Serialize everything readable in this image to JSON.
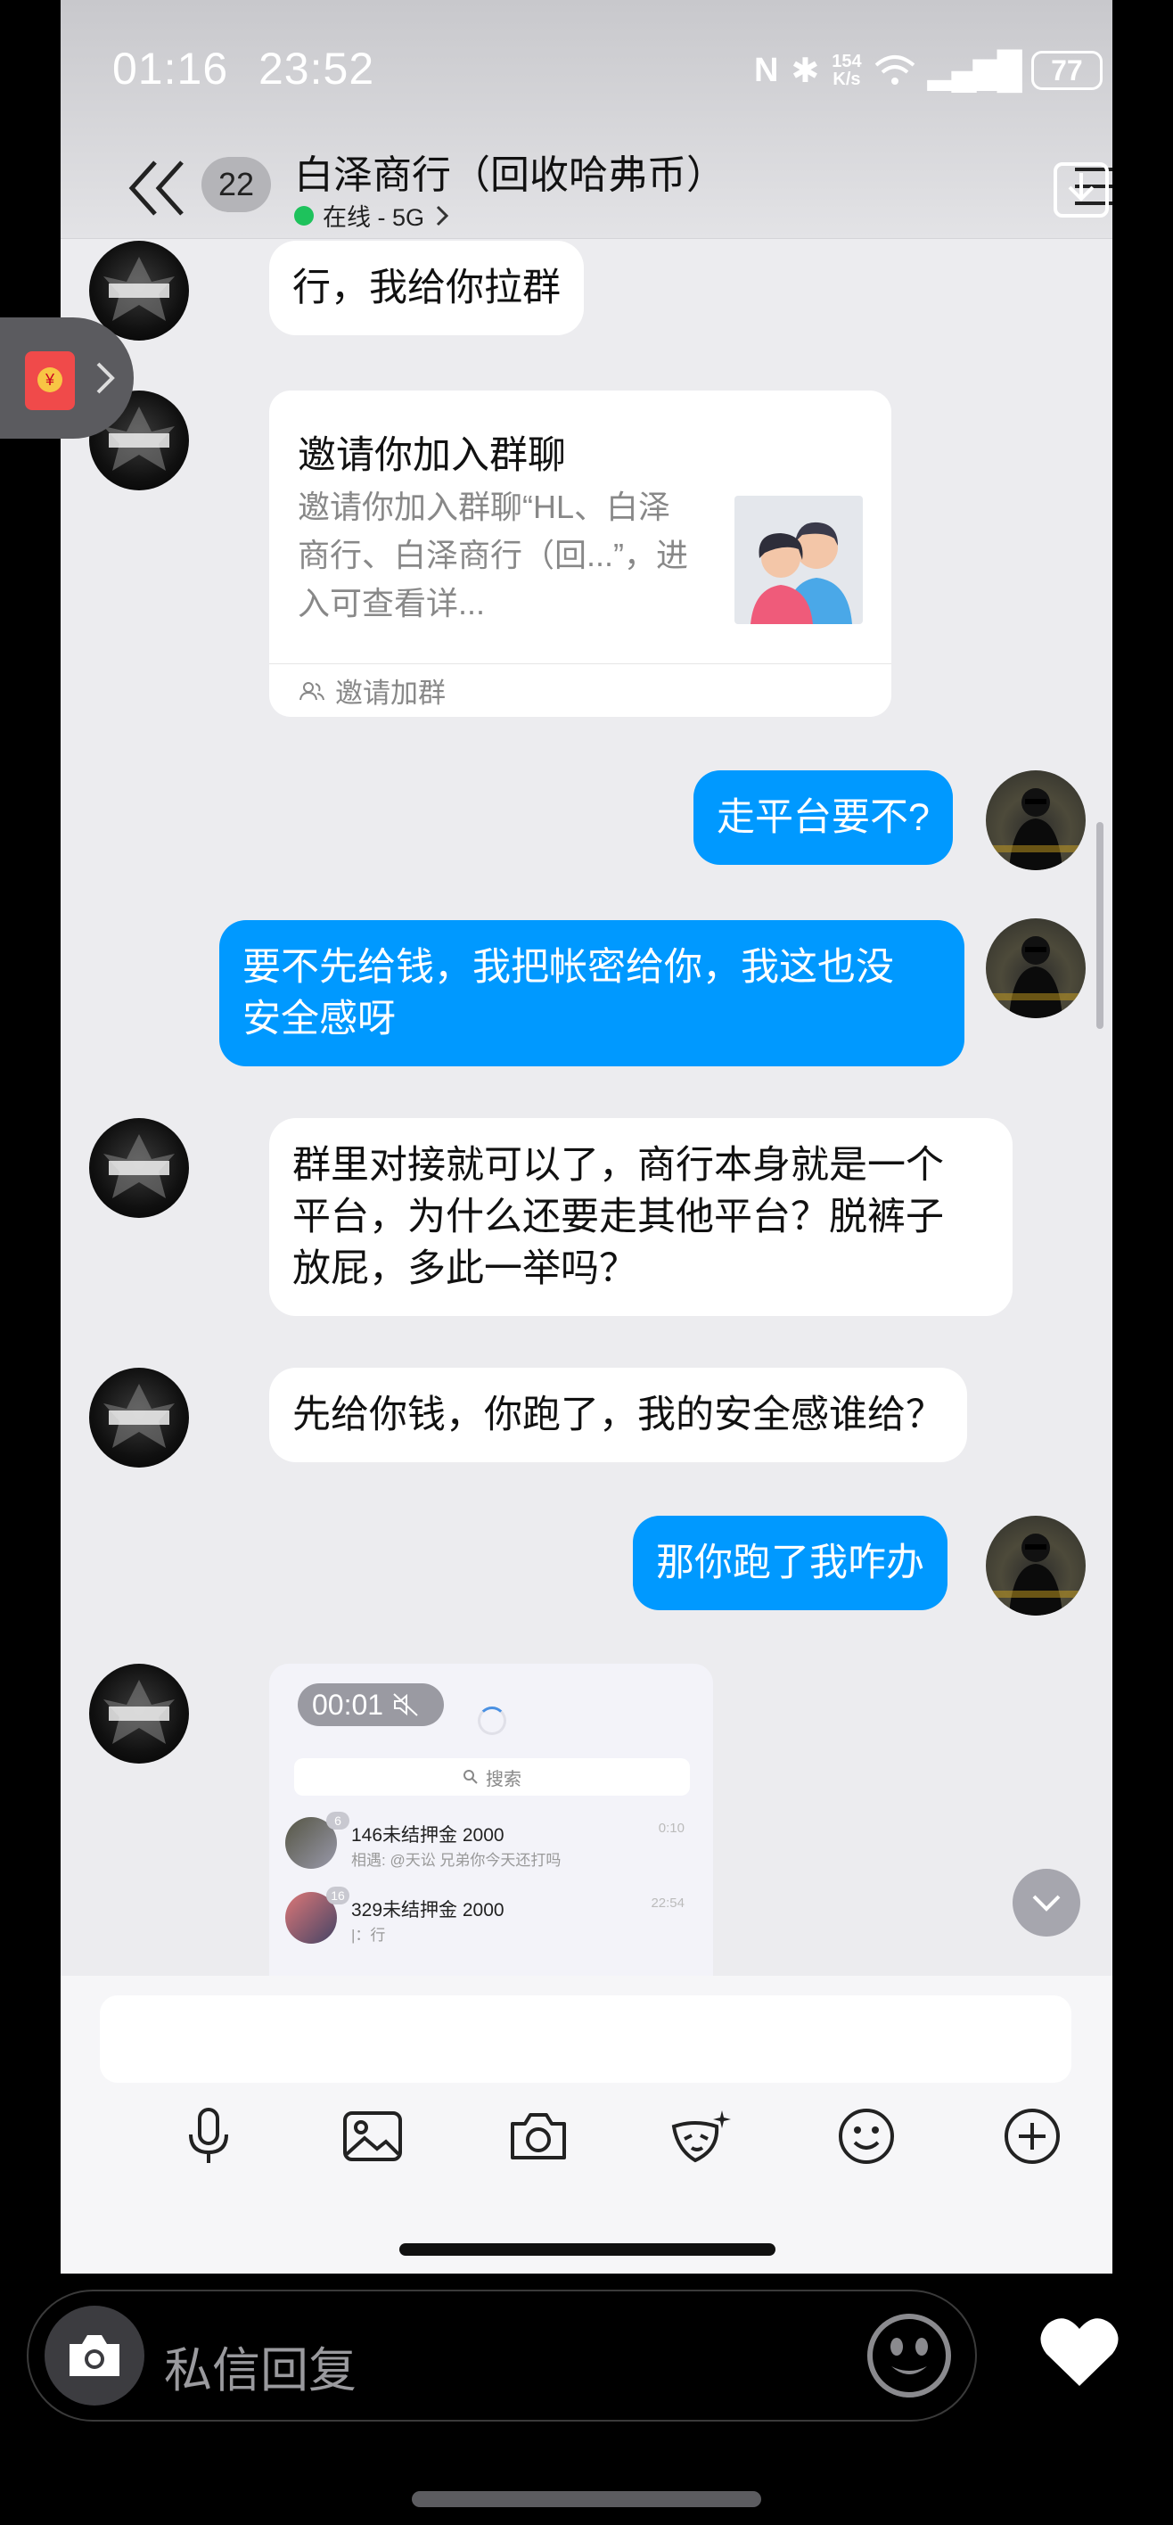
{
  "outer_status": {
    "time": "01:16",
    "net_speed_top": "154",
    "net_speed_unit": "K/s",
    "battery": "77"
  },
  "inner_status": {
    "time": "23:52"
  },
  "header": {
    "unread_count": "22",
    "title": "白泽商行（回收哈弗币）",
    "subtitle": "在线 - 5G"
  },
  "messages": [
    {
      "side": "in",
      "text": "行，我给你拉群"
    },
    {
      "side": "in",
      "type": "group_invite",
      "title": "邀请你加入群聊",
      "desc": "邀请你加入群聊“HL、白泽商行、白泽商行（回...”，进入可查看详...",
      "footer": "邀请加群"
    },
    {
      "side": "out",
      "text": "走平台要不?"
    },
    {
      "side": "out",
      "lines": [
        "要不先给钱，我把帐密给你，我这也没",
        "安全感呀"
      ]
    },
    {
      "side": "in",
      "lines": [
        "群里对接就可以了，商行本身就是一个",
        "平台，为什么还要走其他平台？脱裤子",
        "放屁，多此一举吗？"
      ]
    },
    {
      "side": "in",
      "text": "先给你钱，你跑了，我的安全感谁给？"
    },
    {
      "side": "out",
      "text": "那你跑了我咋办"
    },
    {
      "side": "in",
      "type": "video",
      "duration": "00:01",
      "search": "搜索",
      "items": [
        {
          "badge": "6",
          "name": "146未结押金 2000",
          "sub": "相遇: @天讼 兄弟你今天还打吗",
          "time": "0:10"
        },
        {
          "badge": "16",
          "name": "329未结押金 2000",
          "sub": "|：行",
          "time": "22:54"
        }
      ]
    }
  ],
  "input": {
    "placeholder": ""
  },
  "toolbar_icons": [
    "mic-icon",
    "image-icon",
    "camera-icon",
    "magic-icon",
    "emoji-icon",
    "plus-icon"
  ],
  "reply": {
    "placeholder": "私信回复"
  },
  "colors": {
    "bubble_out": "#0099ff",
    "bubble_in": "#ffffff",
    "online": "#1ec25c"
  }
}
